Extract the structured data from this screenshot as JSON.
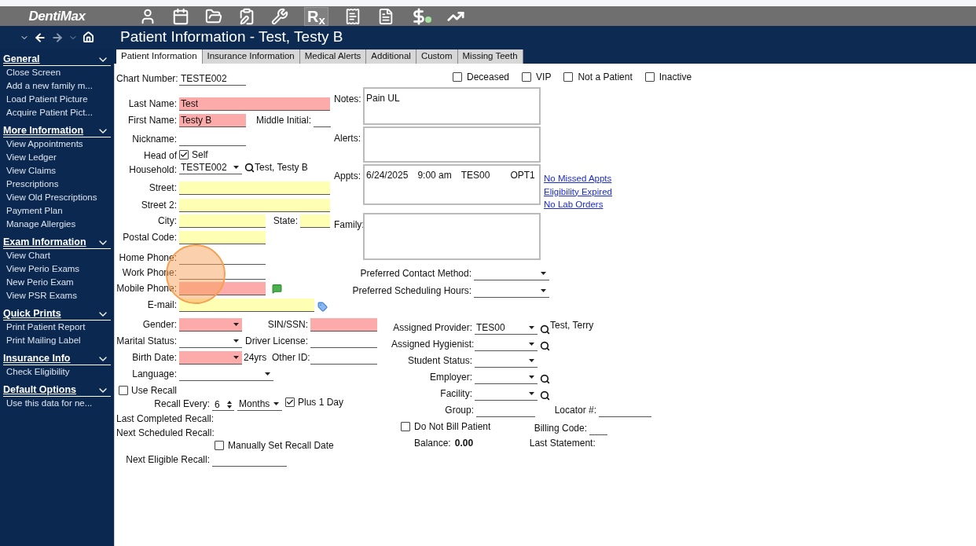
{
  "toolbar": {
    "logo": "DentiMax",
    "rx": "R$_{x}$"
  },
  "title": "Patient Information - Test, Testy B",
  "tabs": [
    {
      "label": "Patient Information",
      "selected": true
    },
    {
      "label": "Insurance Information",
      "selected": false
    },
    {
      "label": "Medical Alerts",
      "selected": false
    },
    {
      "label": "Additional",
      "selected": false
    },
    {
      "label": "Custom",
      "selected": false
    },
    {
      "label": "Missing Teeth",
      "selected": false
    }
  ],
  "sidebar": [
    {
      "title": "General",
      "items": [
        "Close Screen",
        "Add a new family m...",
        "Load Patient Picture",
        "Acquire Patient Pict..."
      ]
    },
    {
      "title": "More Information",
      "items": [
        "View Appointments",
        "View Ledger",
        "View Claims",
        "Prescriptions",
        "View Old Prescriptions",
        "Payment Plan",
        "Manage Allergies"
      ]
    },
    {
      "title": "Exam Information",
      "items": [
        "View Chart",
        "View Perio Exams",
        "New Perio Exam",
        "View PSR Exams"
      ]
    },
    {
      "title": "Quick Prints",
      "items": [
        "Print Patient Report",
        "Print Mailing Label"
      ]
    },
    {
      "title": "Insurance Info",
      "items": [
        "Check Eligibility"
      ]
    },
    {
      "title": "Default Options",
      "items": [
        "Use this data for ne..."
      ]
    }
  ],
  "chart_number": {
    "label": "Chart Number:",
    "value": "TESTE002"
  },
  "flags": [
    {
      "label": "Deceased",
      "checked": false
    },
    {
      "label": "VIP",
      "checked": false
    },
    {
      "label": "Not a Patient",
      "checked": false
    },
    {
      "label": "Inactive",
      "checked": false
    }
  ],
  "name": {
    "last": {
      "label": "Last Name:",
      "value": "Test",
      "color": "#fdaaaa"
    },
    "first": {
      "label": "First Name:",
      "value": "Testy B",
      "color": "#fdaaaa"
    },
    "middle": {
      "label": "Middle Initial:"
    },
    "nickname": {
      "label": "Nickname:"
    }
  },
  "household": {
    "label_1": "Head of",
    "label_2": "Household:",
    "self_label": "Self",
    "self_checked": true,
    "value": "TESTE002",
    "name": "Test, Testy B"
  },
  "address": {
    "street": {
      "label": "Street:",
      "color": "#ffffb3"
    },
    "street2": {
      "label": "Street 2:",
      "color": "#ffffb3"
    },
    "city": {
      "label": "City:",
      "color": "#ffffb3"
    },
    "state": {
      "label": "State:",
      "color": "#ffffb3"
    },
    "postal": {
      "label": "Postal Code:",
      "color": "#ffffb3"
    }
  },
  "phones": {
    "home": {
      "label": "Home Phone:"
    },
    "work": {
      "label": "Work Phone:"
    },
    "mobile": {
      "label": "Mobile Phone:",
      "color": "#fdaaaa"
    },
    "email": {
      "label": "E-mail:",
      "color": "#ffffb3"
    }
  },
  "boxes": {
    "notes": {
      "label": "Notes:",
      "text": "Pain UL"
    },
    "alerts": {
      "label": "Alerts:"
    },
    "appts": {
      "label": "Appts:",
      "date": "6/24/2025",
      "time": "9:00 am",
      "provider": "TES00",
      "operatory": "OPT1"
    },
    "family": {
      "label": "Family:"
    }
  },
  "links": [
    "No Missed Appts",
    "Eligibility Expired",
    "No Lab Orders"
  ],
  "preferences": [
    {
      "label": "Preferred Contact Method:"
    },
    {
      "label": "Preferred Scheduling Hours:"
    }
  ],
  "demographics": {
    "gender": {
      "label": "Gender:",
      "color": "#fdaaaa"
    },
    "ssn": {
      "label": "SIN/SSN:",
      "color": "#fdaaaa"
    },
    "marital": {
      "label": "Marital Status:"
    },
    "license": {
      "label": "Driver License:"
    },
    "birth": {
      "label": "Birth Date:",
      "color": "#fdaaaa",
      "age": "24yrs"
    },
    "other_id": {
      "label": "Other ID:"
    },
    "language": {
      "label": "Language:"
    }
  },
  "recall": {
    "use_label": "Use Recall",
    "use_checked": false,
    "every_label": "Recall Every:",
    "every_value": "6",
    "unit": "Months",
    "plus_label": "Plus 1 Day",
    "plus_checked": true,
    "last_completed": "Last Completed Recall:",
    "next_scheduled": "Next Scheduled Recall:",
    "manual_label": "Manually Set Recall Date",
    "manual_checked": false,
    "next_eligible": "Next Eligible Recall:"
  },
  "assignments": {
    "provider": {
      "label": "Assigned Provider:",
      "value": "TES00",
      "name": "Test, Terry"
    },
    "hygienist": {
      "label": "Assigned Hygienist:"
    },
    "student": {
      "label": "Student Status:"
    },
    "employer": {
      "label": "Employer:"
    },
    "facility": {
      "label": "Facility:"
    },
    "group": {
      "label": "Group:"
    },
    "locator": {
      "label": "Locator #:"
    },
    "no_bill_label": "Do Not Bill Patient",
    "no_bill_checked": false,
    "billing_code": {
      "label": "Billing Code:"
    },
    "balance_label": "Balance:",
    "balance": "0.00",
    "last_statement": "Last Statement:"
  },
  "click_highlight": true
}
